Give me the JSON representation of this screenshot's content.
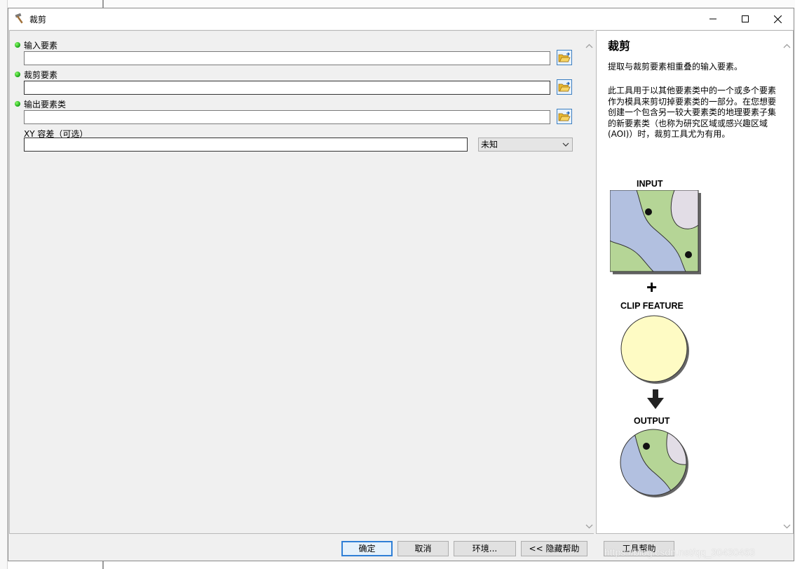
{
  "window": {
    "title": "裁剪",
    "icon": "hammer-icon"
  },
  "params": {
    "input_label": "输入要素",
    "clip_label": "裁剪要素",
    "output_label": "输出要素类",
    "xy_label": "XY 容差（可选）",
    "xy_unit": "未知"
  },
  "help": {
    "title": "裁剪",
    "p1": "提取与裁剪要素相重叠的输入要素。",
    "p2": "此工具用于以其他要素类中的一个或多个要素作为模具来剪切掉要素类的一部分。在您想要创建一个包含另一较大要素类的地理要素子集的新要素类（也称为研究区域或感兴趣区域 (AOI)）时，裁剪工具尤为有用。",
    "diagram": {
      "input": "INPUT",
      "plus": "+",
      "clip": "CLIP FEATURE",
      "output": "OUTPUT"
    }
  },
  "buttons": {
    "ok": "确定",
    "cancel": "取消",
    "env": "环境...",
    "hide_help": "<< 隐藏帮助",
    "tool_help": "工具帮助"
  },
  "watermark": "https://blog.csdn.net/qq_30430463",
  "colors": {
    "required_dot": "#16a314",
    "land": "#b5d596",
    "water": "#b2c0e0",
    "clip": "#fefbc4",
    "other": "#e2dde6",
    "default_button_border": "#2f7fd6"
  }
}
